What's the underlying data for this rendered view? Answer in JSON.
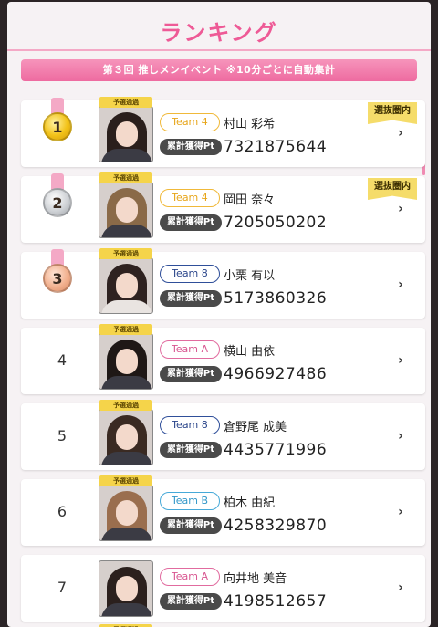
{
  "header": {
    "title": "ランキング",
    "banner": "第３回 推しメンイベント ※10分ごとに自動集計"
  },
  "labels": {
    "yosen": "予選通過",
    "pt_label": "累計獲得Pt",
    "senbatsu": "選抜圏内",
    "chevron": "›"
  },
  "colors": {
    "accent": "#ee5a96",
    "badge": "#f5d44a"
  },
  "ranking": [
    {
      "rank": "1",
      "medal": "gold",
      "team": "Team 4",
      "name": "村山 彩希",
      "points": "7321875644",
      "senbatsu": true,
      "yosen": true
    },
    {
      "rank": "2",
      "medal": "silver",
      "team": "Team 4",
      "name": "岡田 奈々",
      "points": "7205050202",
      "senbatsu": true,
      "yosen": true
    },
    {
      "rank": "3",
      "medal": "bronze",
      "team": "Team 8",
      "name": "小栗 有以",
      "points": "5173860326",
      "senbatsu": false,
      "yosen": true
    },
    {
      "rank": "4",
      "medal": "",
      "team": "Team A",
      "name": "横山 由依",
      "points": "4966927486",
      "senbatsu": false,
      "yosen": true
    },
    {
      "rank": "5",
      "medal": "",
      "team": "Team 8",
      "name": "倉野尾 成美",
      "points": "4435771996",
      "senbatsu": false,
      "yosen": true
    },
    {
      "rank": "6",
      "medal": "",
      "team": "Team B",
      "name": "柏木 由紀",
      "points": "4258329870",
      "senbatsu": false,
      "yosen": true
    },
    {
      "rank": "7",
      "medal": "",
      "team": "Team A",
      "name": "向井地 美音",
      "points": "4198512657",
      "senbatsu": false,
      "yosen": false
    }
  ]
}
